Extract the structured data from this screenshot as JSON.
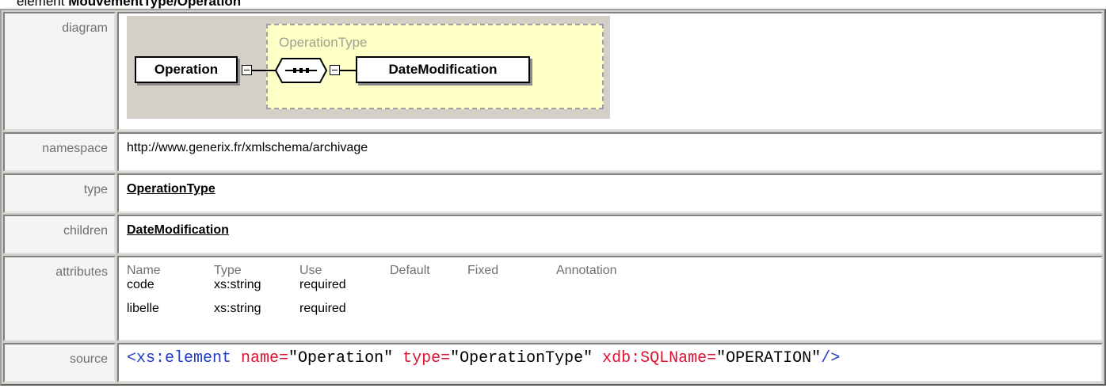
{
  "heading": {
    "prefix": "element ",
    "name": "MouvementType/Operation"
  },
  "labels": {
    "diagram": "diagram",
    "namespace": "namespace",
    "type": "type",
    "children": "children",
    "attributes": "attributes",
    "source": "source"
  },
  "diagram": {
    "element": "Operation",
    "complex_type": "OperationType",
    "child": "DateModification"
  },
  "namespace": "http://www.generix.fr/xmlschema/archivage",
  "type": "OperationType",
  "children": "DateModification",
  "attributes": {
    "headers": [
      "Name",
      "Type",
      "Use",
      "Default",
      "Fixed",
      "Annotation"
    ],
    "rows": [
      {
        "name": "code",
        "type": "xs:string",
        "use": "required",
        "default": "",
        "fixed": "",
        "annotation": ""
      },
      {
        "name": "libelle",
        "type": "xs:string",
        "use": "required",
        "default": "",
        "fixed": "",
        "annotation": ""
      }
    ]
  },
  "source": {
    "open": "<xs:element",
    "attr1_name": " name=",
    "attr1_value": "\"Operation\"",
    "attr2_name": " type=",
    "attr2_value": "\"OperationType\"",
    "attr3_name": " xdb:SQLName=",
    "attr3_value": "\"OPERATION\"",
    "close": "/>"
  },
  "colors": {
    "tag": "#1e3cc8",
    "attr": "#e01030",
    "type_box": "#ffffc8",
    "frame": "#d4d0c8"
  }
}
